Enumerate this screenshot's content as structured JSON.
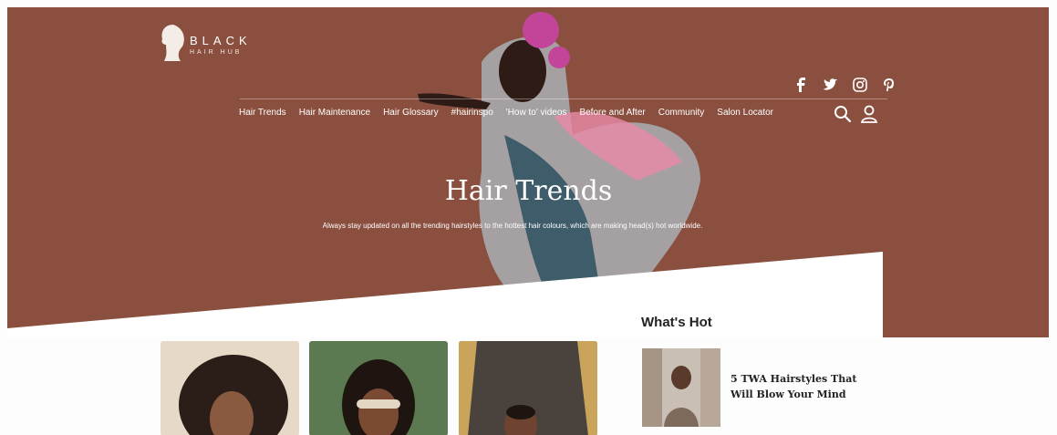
{
  "brand": {
    "line1": "BLACK",
    "line2": "HAIR HUB"
  },
  "social": [
    "facebook-icon",
    "twitter-icon",
    "instagram-icon",
    "pinterest-icon"
  ],
  "nav": {
    "items": [
      "Hair Trends",
      "Hair Maintenance",
      "Hair Glossary",
      "#hairinspo",
      "'How to' videos",
      "Before and After",
      "Community",
      "Salon Locator"
    ]
  },
  "hero": {
    "title": "Hair Trends",
    "subtitle": "Always stay updated on all the trending hairstyles to the hottest hair colours, which are making head(s) hot worldwide."
  },
  "sidebar": {
    "heading": "What's Hot",
    "items": [
      {
        "title": "5 TWA Hairstyles That Will Blow Your Mind"
      }
    ]
  },
  "colors": {
    "hero": "#8a4f3e",
    "white": "#ffffff"
  }
}
